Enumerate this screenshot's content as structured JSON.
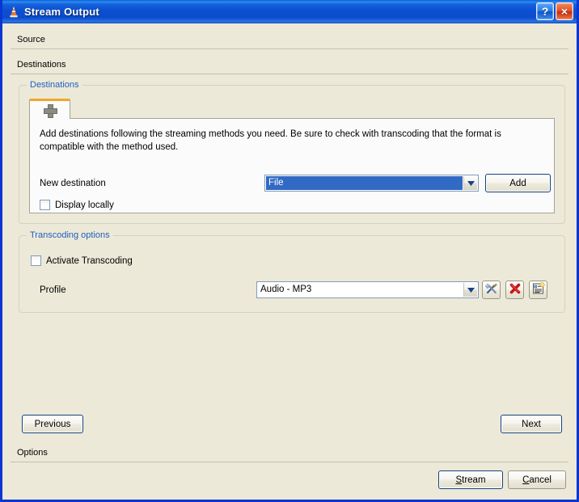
{
  "window": {
    "title": "Stream Output",
    "app_icon": "vlc-cone-icon",
    "help_button": "?",
    "close_button": "×",
    "accent_title_blue": "#0C4FD0",
    "dialog_background": "#ECE9D8"
  },
  "sections": {
    "source_label": "Source",
    "destinations_label": "Destinations",
    "options_label": "Options"
  },
  "destinations_group": {
    "title": "Destinations",
    "tab_icon": "plus-icon",
    "hint": "Add destinations following the streaming methods you need. Be sure to check with transcoding that the format is compatible with the method used.",
    "new_destination_label": "New destination",
    "new_destination_value": "File",
    "add_button": "Add",
    "display_locally_label": "Display locally",
    "display_locally_checked": false
  },
  "transcoding_group": {
    "title": "Transcoding options",
    "activate_label": "Activate Transcoding",
    "activate_checked": false,
    "profile_label": "Profile",
    "profile_value": "Audio - MP3",
    "edit_icon": "wrench-screwdriver-icon",
    "delete_icon": "red-x-icon",
    "new_icon": "new-profile-icon"
  },
  "navigation": {
    "previous_label": "Previous",
    "next_label": "Next"
  },
  "dialog_buttons": {
    "stream_label": "Stream",
    "stream_mnemonic": "S",
    "stream_rest": "tream",
    "cancel_label": "Cancel",
    "cancel_mnemonic": "C",
    "cancel_rest": "ancel"
  }
}
